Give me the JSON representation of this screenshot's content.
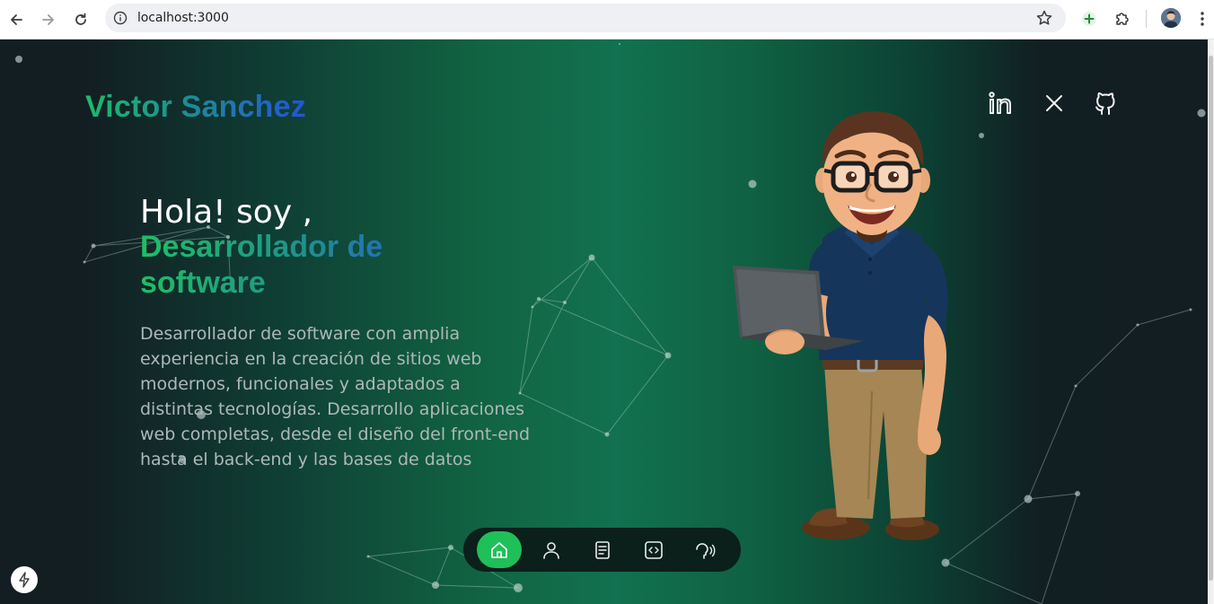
{
  "browser": {
    "url": "localhost:3000",
    "icons": [
      "back-icon",
      "forward-icon",
      "reload-icon",
      "site-info-icon",
      "bookmark-star-icon",
      "extension-plus-icon",
      "extensions-puzzle-icon",
      "profile-avatar",
      "menu-kebab-icon"
    ]
  },
  "header": {
    "brand": "Victor Sanchez",
    "social": [
      "linkedin-icon",
      "x-icon",
      "github-icon"
    ]
  },
  "hero": {
    "greeting": "Hola! soy ,",
    "role": "Desarrollador de software",
    "description": "Desarrollador de software con amplia experiencia en la creación de sitios web modernos, funcionales y adaptados a distintas tecnologías. Desarrollo aplicaciones web completas, desde el diseño del front-end hasta el back-end y las bases de datos"
  },
  "dock": {
    "items": [
      "home-icon",
      "user-icon",
      "document-icon",
      "code-icon",
      "contact-speech-icon"
    ],
    "active": "home-icon"
  },
  "colors": {
    "accent_green": "#1fbf5a",
    "brand_blue": "#2553d6",
    "background": "#131e22"
  }
}
